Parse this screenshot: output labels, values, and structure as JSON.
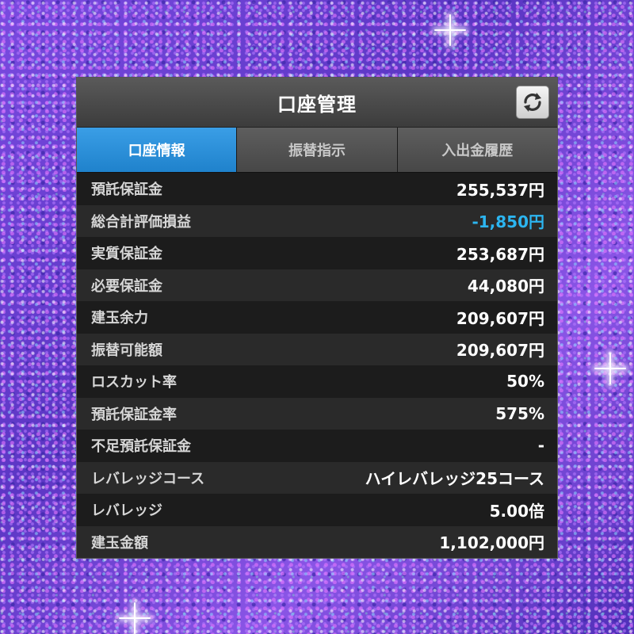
{
  "header": {
    "title": "口座管理",
    "refresh_icon": "refresh-icon"
  },
  "tabs": [
    {
      "label": "口座情報",
      "active": true
    },
    {
      "label": "振替指示",
      "active": false
    },
    {
      "label": "入出金履歴",
      "active": false
    }
  ],
  "rows": [
    {
      "label": "預託保証金",
      "value": "255,537円"
    },
    {
      "label": "総合計評価損益",
      "value": "-1,850円"
    },
    {
      "label": "実質保証金",
      "value": "253,687円"
    },
    {
      "label": "必要保証金",
      "value": "44,080円"
    },
    {
      "label": "建玉余力",
      "value": "209,607円"
    },
    {
      "label": "振替可能額",
      "value": "209,607円"
    },
    {
      "label": "ロスカット率",
      "value": "50%"
    },
    {
      "label": "預託保証金率",
      "value": "575%"
    },
    {
      "label": "不足預託保証金",
      "value": "-"
    },
    {
      "label": "レバレッジコース",
      "value": "ハイレバレッジ25コース"
    },
    {
      "label": "レバレッジ",
      "value": "5.00倍"
    },
    {
      "label": "建玉金額",
      "value": "1,102,000円"
    }
  ],
  "colors": {
    "accent_tab": "#2a8fd9",
    "negative_value": "#2cb5f0",
    "background_glitter": "#6a3fd0"
  }
}
